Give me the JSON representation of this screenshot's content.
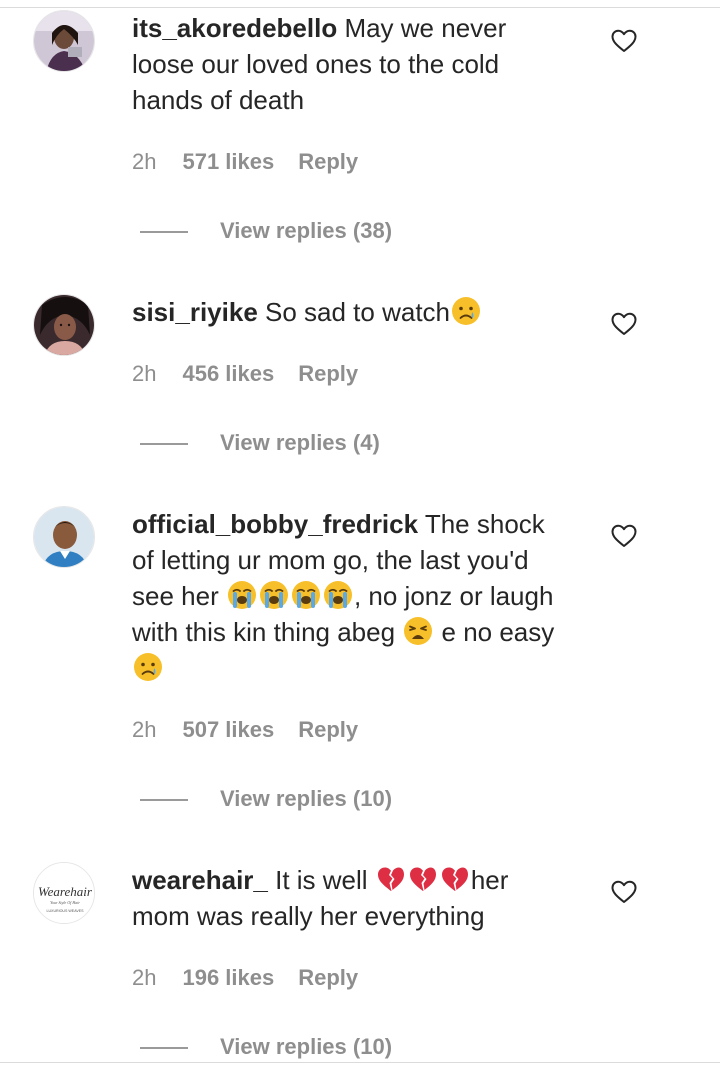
{
  "comments": [
    {
      "username": "its_akoredebello",
      "text": "May we never loose our loved ones to the cold hands of death",
      "time": "2h",
      "likes": "571 likes",
      "reply_label": "Reply",
      "view_replies": "View replies (38)"
    },
    {
      "username": "sisi_riyike",
      "text": "So sad to watch",
      "time": "2h",
      "likes": "456 likes",
      "reply_label": "Reply",
      "view_replies": "View replies (4)"
    },
    {
      "username": "official_bobby_fredrick",
      "text_1": "The shock of letting ur mom go, the last you'd see her",
      "text_2": ", no jonz or laugh with this kin thing abeg",
      "text_3": "e no easy",
      "time": "2h",
      "likes": "507 likes",
      "reply_label": "Reply",
      "view_replies": "View replies (10)"
    },
    {
      "username": "wearehair_",
      "text_1": "It is well",
      "text_2": "her mom was really her everything",
      "time": "2h",
      "likes": "196 likes",
      "reply_label": "Reply",
      "view_replies": "View replies (10)"
    }
  ],
  "logo": {
    "brand": "Wearehair",
    "tagline": "Your Style Of Hair",
    "sub": "LUXURIOUS WEAVES"
  },
  "icons": {
    "like": "heart-outline-icon",
    "emoji_cry": "crying-face-emoji",
    "emoji_sob": "loudly-crying-face-emoji",
    "emoji_weary": "weary-face-emoji",
    "emoji_broken": "broken-heart-emoji"
  },
  "colors": {
    "text": "#262626",
    "muted": "#8e8e8e",
    "divider": "#dbdbdb",
    "emoji_yellow": "#f7c02a",
    "broken_heart": "#dd2e44"
  }
}
